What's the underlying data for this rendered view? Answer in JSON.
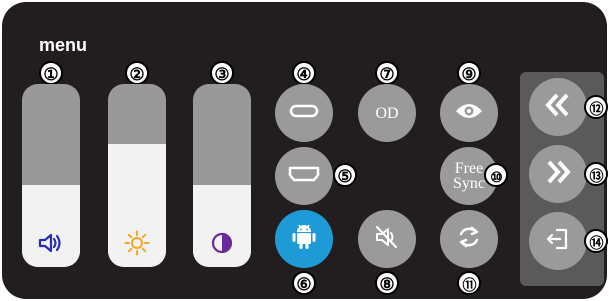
{
  "menu": {
    "title": "menu"
  },
  "sliders": [
    {
      "badge": "①",
      "icon": "speaker-icon",
      "level": 0.45,
      "icon_color": "#2a2ab8"
    },
    {
      "badge": "②",
      "icon": "sun-icon",
      "level": 0.67,
      "icon_color": "#f5a623"
    },
    {
      "badge": "③",
      "icon": "contrast-icon",
      "level": 0.45,
      "icon_color": "#6a2a9a"
    }
  ],
  "buttons": {
    "b4": {
      "badge": "④",
      "icon": "usb-c-icon"
    },
    "b5": {
      "badge": "⑤",
      "icon": "hdmi-icon"
    },
    "b6": {
      "badge": "⑥",
      "icon": "android-icon"
    },
    "b7": {
      "badge": "⑦",
      "label": "OD"
    },
    "b8": {
      "badge": "⑧",
      "icon": "mute-icon"
    },
    "b9": {
      "badge": "⑨",
      "icon": "eye-icon"
    },
    "b10": {
      "badge": "⑩",
      "label_line1": "Free",
      "label_line2": "Sync"
    },
    "b11": {
      "badge": "⑪",
      "icon": "rotate-icon"
    },
    "b12": {
      "badge": "⑫",
      "icon": "double-chevron-left-icon"
    },
    "b13": {
      "badge": "⑬",
      "icon": "double-chevron-right-icon"
    },
    "b14": {
      "badge": "⑭",
      "icon": "exit-icon"
    }
  },
  "colors": {
    "background": "#221d1e",
    "button": "#9a9a9a",
    "active_button": "#1e9bd7",
    "slider_track": "#999999",
    "slider_fill": "#f2f2f2",
    "nav_panel": "#5a5a5a"
  }
}
